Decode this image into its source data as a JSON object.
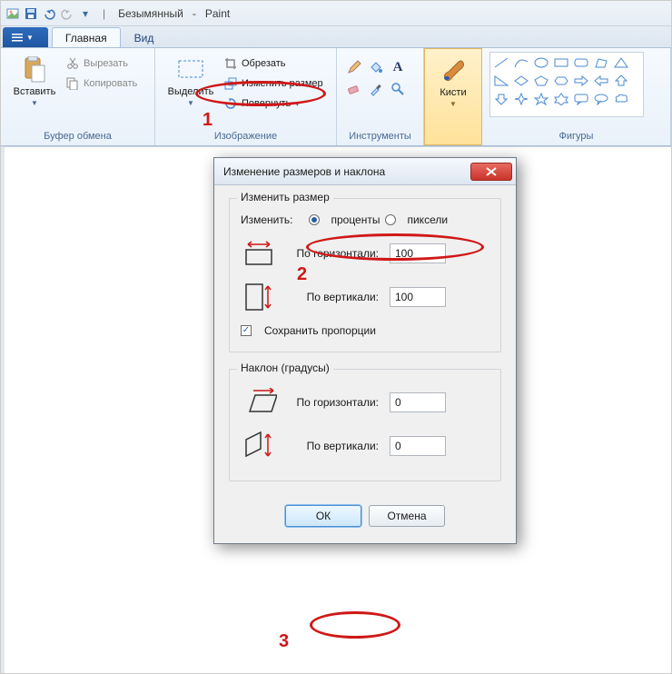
{
  "titlebar": {
    "doc_name": "Безымянный",
    "app_name": "Paint"
  },
  "ribbon": {
    "file_tab": "",
    "tabs": {
      "home": "Главная",
      "view": "Вид"
    },
    "clipboard": {
      "paste": "Вставить",
      "cut": "Вырезать",
      "copy": "Копировать",
      "label": "Буфер обмена"
    },
    "image": {
      "select": "Выделить",
      "crop": "Обрезать",
      "resize": "Изменить размер",
      "rotate": "Повернуть",
      "label": "Изображение"
    },
    "tools": {
      "label": "Инструменты"
    },
    "brushes": {
      "label": "Кисти"
    },
    "shapes": {
      "label": "Фигуры"
    }
  },
  "dialog": {
    "title": "Изменение размеров и наклона",
    "resize_title": "Изменить размер",
    "by_label": "Изменить:",
    "units_percent": "проценты",
    "units_pixels": "пиксели",
    "horiz_label": "По горизонтали:",
    "vert_label": "По вертикали:",
    "horiz_value": "100",
    "vert_value": "100",
    "keep_aspect": "Сохранить пропорции",
    "skew_title": "Наклон (градусы)",
    "skew_horiz_value": "0",
    "skew_vert_value": "0",
    "ok": "ОК",
    "cancel": "Отмена"
  },
  "annotations": {
    "n1": "1",
    "n2": "2",
    "n3": "3"
  }
}
